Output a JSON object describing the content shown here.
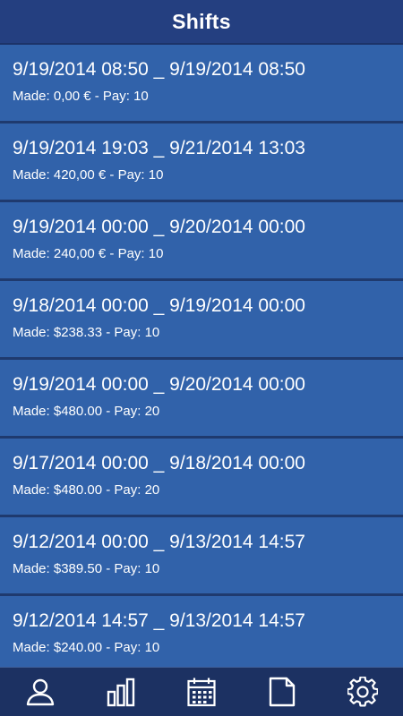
{
  "header": {
    "title": "Shifts"
  },
  "shifts": [
    {
      "times": "9/19/2014 08:50 _ 9/19/2014 08:50",
      "detail": "Made: 0,00 € - Pay: 10"
    },
    {
      "times": "9/19/2014 19:03 _ 9/21/2014 13:03",
      "detail": "Made: 420,00 € - Pay: 10"
    },
    {
      "times": "9/19/2014 00:00 _ 9/20/2014 00:00",
      "detail": "Made: 240,00 € - Pay: 10"
    },
    {
      "times": "9/18/2014 00:00 _ 9/19/2014 00:00",
      "detail": "Made: $238.33 - Pay: 10"
    },
    {
      "times": "9/19/2014 00:00 _ 9/20/2014 00:00",
      "detail": "Made: $480.00 - Pay: 20"
    },
    {
      "times": "9/17/2014 00:00 _ 9/18/2014 00:00",
      "detail": "Made: $480.00 - Pay: 20"
    },
    {
      "times": "9/12/2014 00:00 _ 9/13/2014 14:57",
      "detail": "Made: $389.50 - Pay: 10"
    },
    {
      "times": "9/12/2014 14:57 _ 9/13/2014 14:57",
      "detail": "Made: $240.00 - Pay: 10"
    }
  ],
  "tabbar": {
    "items": [
      {
        "icon": "person-icon"
      },
      {
        "icon": "bar-chart-icon"
      },
      {
        "icon": "calendar-icon"
      },
      {
        "icon": "document-icon"
      },
      {
        "icon": "gear-icon"
      }
    ]
  },
  "colors": {
    "header_bg": "#243f80",
    "row_bg": "#3162aa",
    "row_divider": "#1f3a6e",
    "tabbar_bg": "#1c3162",
    "text": "#ffffff"
  }
}
